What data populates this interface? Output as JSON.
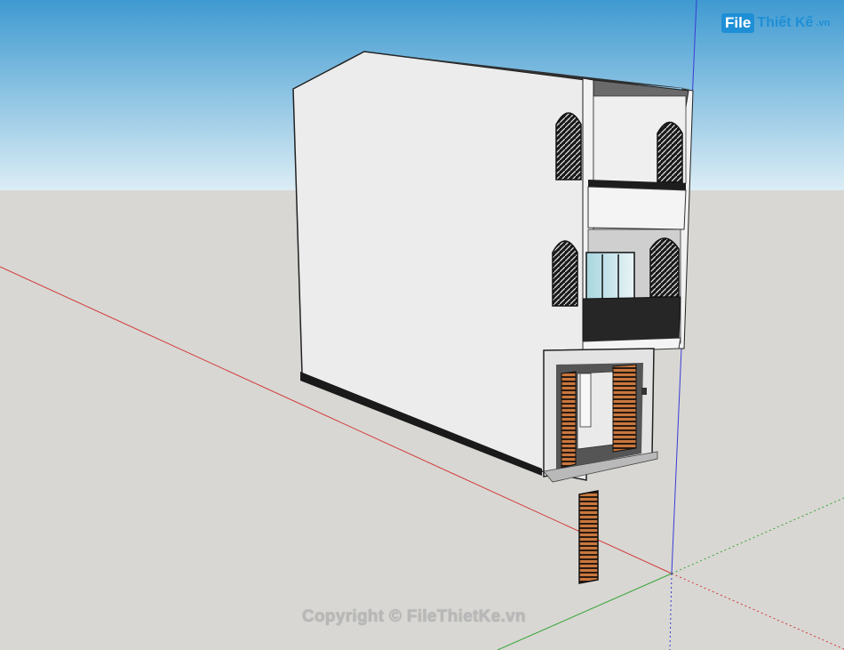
{
  "watermark": {
    "logo_file": "File",
    "logo_rest": "Thiết Kế",
    "logo_suffix": ".vn",
    "copyright": "Copyright © FileThietKe.vn"
  },
  "colors": {
    "sky_top": "#3f9ad1",
    "sky_bottom": "#d9ecf5",
    "ground": "#d8d7d3",
    "axis_red": "#d23b3b",
    "axis_green": "#3aa63a",
    "axis_blue": "#3b3bd6",
    "wall": "#ececec",
    "shutter": "#c9773e"
  },
  "icons": {
    "logo": "filethietke-logo-icon"
  }
}
